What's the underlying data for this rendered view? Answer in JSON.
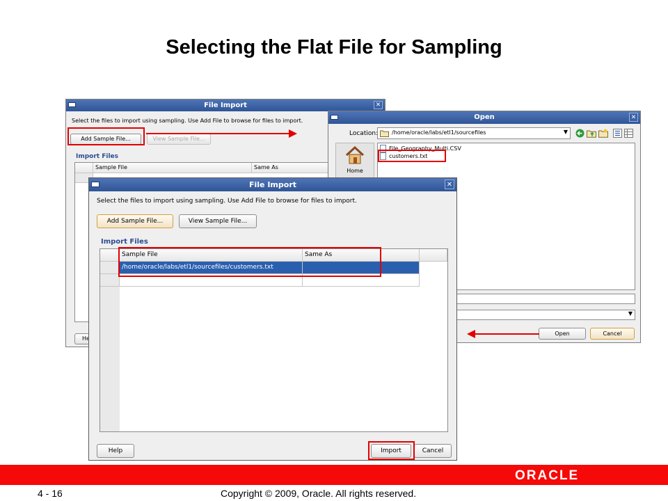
{
  "slide": {
    "title": "Selecting the Flat File for Sampling",
    "page_number": "4 - 16",
    "copyright": "Copyright © 2009, Oracle. All rights reserved.",
    "logo_text": "ORACLE"
  },
  "back_import_dialog": {
    "title": "File Import",
    "instruction": "Select the files to import using sampling.  Use Add File to browse for files to import.",
    "add_label": "Add Sample File...",
    "view_label": "View Sample File...",
    "section": "Import Files",
    "col_sample": "Sample File",
    "col_same_as": "Same As",
    "help_partial": "He"
  },
  "open_dialog": {
    "title": "Open",
    "location_label": "Location:",
    "location_value": "/home/oracle/labs/etl1/sourcefiles",
    "places_home": "Home",
    "files": [
      "File_Geography_Multi.CSV",
      "customers.txt"
    ],
    "open_label": "Open",
    "cancel_label": "Cancel"
  },
  "front_import_dialog": {
    "title": "File Import",
    "instruction": "Select the files to import using sampling.  Use Add File to browse for files to import.",
    "add_label": "Add Sample File...",
    "view_label": "View Sample File...",
    "section": "Import Files",
    "col_sample": "Sample File",
    "col_same_as": "Same As",
    "row1_file": "/home/oracle/labs/etl1/sourcefiles/customers.txt",
    "row1_same_as": "",
    "help_label": "Help",
    "import_label": "Import",
    "cancel_label": "Cancel"
  },
  "colors": {
    "titlebar": "#2f5597",
    "highlight_box": "#e20000",
    "selected_row": "#2a5fae",
    "footer_bar": "#f60909",
    "section_label": "#2a4d8f"
  }
}
